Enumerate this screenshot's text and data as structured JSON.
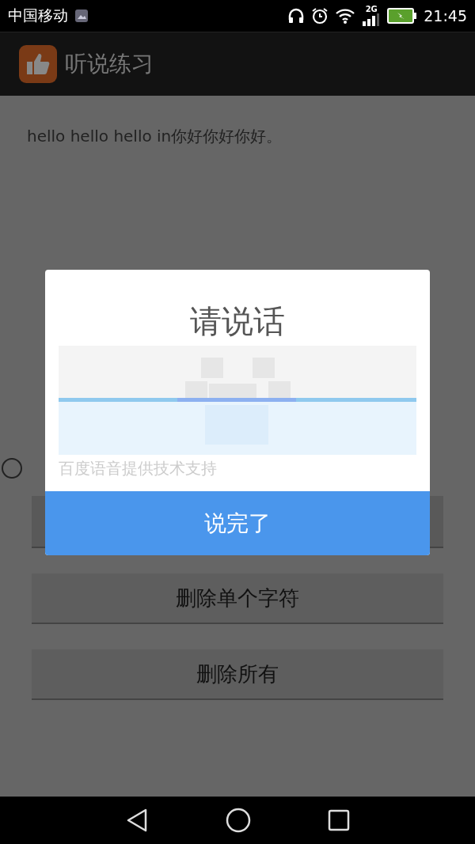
{
  "status_bar": {
    "carrier": "中国移动",
    "network": "2G",
    "time": "21:45"
  },
  "app_bar": {
    "title": "听说练习"
  },
  "content": {
    "text": "hello hello hello in你好你好你好。"
  },
  "buttons": [
    "删除单个字符",
    "删除所有"
  ],
  "dialog": {
    "title": "请说话",
    "credit": "百度语音提供技术支持",
    "button": "说完了"
  }
}
